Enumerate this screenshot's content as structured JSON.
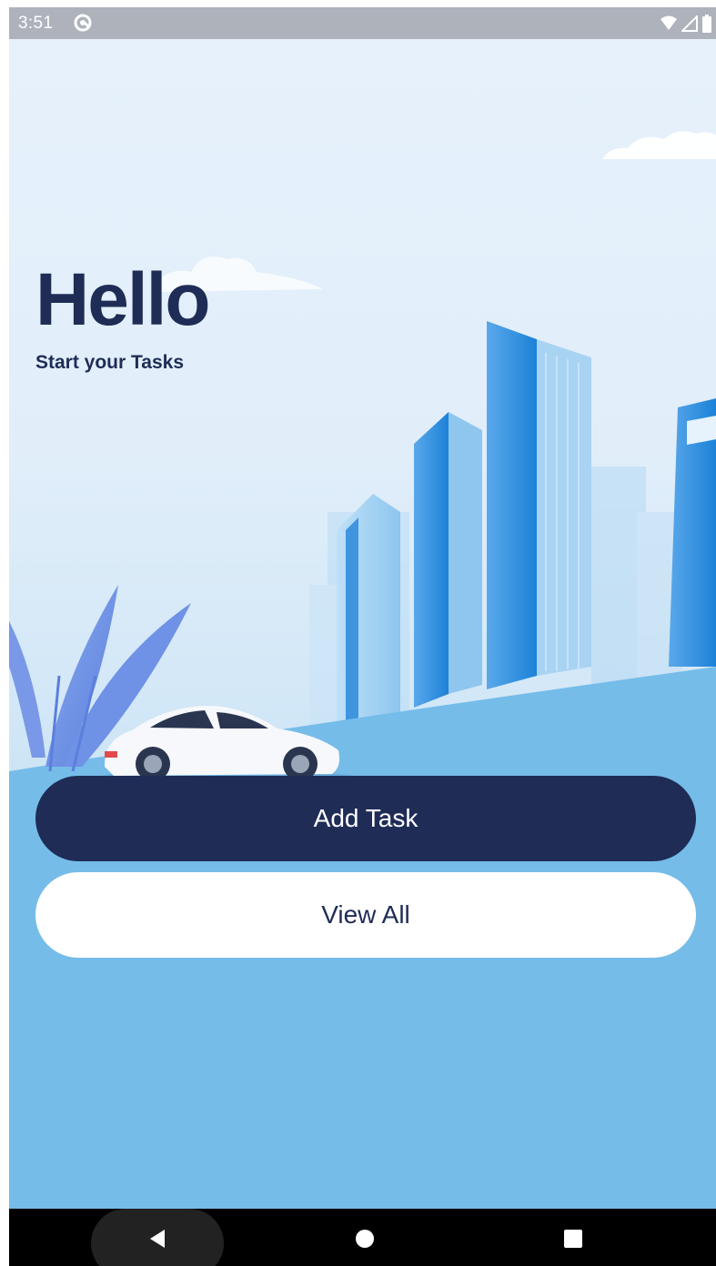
{
  "status_bar": {
    "time": "3:51",
    "icons": [
      "at-sign-icon",
      "wifi-icon",
      "signal-icon",
      "battery-icon"
    ]
  },
  "main": {
    "title": "Hello",
    "subtitle": "Start your Tasks",
    "illustration": [
      "city-buildings-illustration",
      "plant-illustration",
      "white-car-illustration",
      "clouds-illustration"
    ]
  },
  "buttons": {
    "add_task": "Add Task",
    "view_all": "View All"
  },
  "nav_bar": {
    "icons": [
      "back-icon",
      "home-icon",
      "recents-icon"
    ]
  },
  "colors": {
    "primary_navy": "#1f2c56",
    "sky_blue": "#75bce9",
    "status_bar": "#adb2bb",
    "button_white": "#ffffff"
  }
}
